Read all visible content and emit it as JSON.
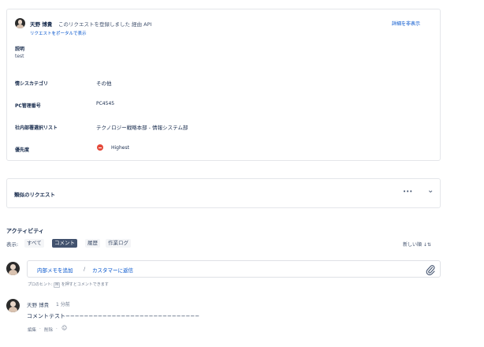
{
  "request": {
    "author": "天野 博貴",
    "action": "このリクエストを登録しました 経由 API",
    "portal_link": "リクエストをポータルで表示",
    "hide_details": "詳細を非表示",
    "description_label": "説明",
    "description_value": "test",
    "fields": [
      {
        "label": "情シスカテゴリ",
        "value": "その他"
      },
      {
        "label": "PC管理番号",
        "value": "PC4545"
      },
      {
        "label": "社内部署選択リスト",
        "value": "テクノロジー戦略本部 - 情報システム部"
      },
      {
        "label": "優先度",
        "value": "Highest"
      }
    ]
  },
  "similar": {
    "title": "類似のリクエスト",
    "more_icon": "•••",
    "chevron_icon": "⌄"
  },
  "activity": {
    "heading": "アクティビティ",
    "show_label": "表示:",
    "filters": [
      "すべて",
      "コメント",
      "履歴",
      "作業ログ"
    ],
    "active_filter": "コメント",
    "sort_label": "新しい順 ↓⇅"
  },
  "composer": {
    "internal_note": "内部メモを追加",
    "separator": "/",
    "reply_customer": "カスタマーに返信",
    "attach_icon": "paperclip-icon",
    "tip_prefix": "プロのヒント: ",
    "tip_key": "M",
    "tip_suffix": " を押すとコメントできます"
  },
  "comment": {
    "author": "天野 博貴",
    "time": "1 分前",
    "body": "コメントテスト−−−−−−−−−−−−−−−−−−−−−−−−−−−−−",
    "edit": "編集",
    "dot1": "·",
    "delete": "削除",
    "dot2": "·",
    "emoji_icon": "☺"
  },
  "colors": {
    "link": "#0052cc",
    "priority_highest": "#e5493a",
    "active_chip": "#42526e"
  }
}
